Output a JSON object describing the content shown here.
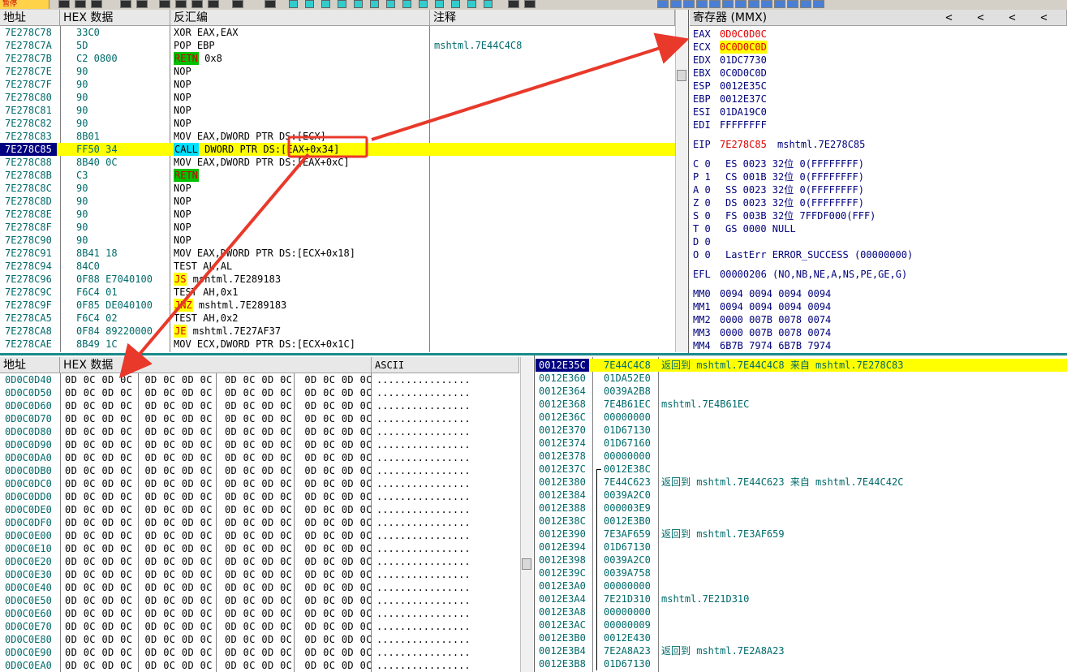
{
  "toolbar": {
    "label": "暂停"
  },
  "cpu": {
    "headers": {
      "addr": "地址",
      "hex": "HEX 数据",
      "disasm": "反汇编",
      "comment": "注释"
    },
    "rows": [
      {
        "addr": "7E278C78",
        "hex": "33C0",
        "disasm": "XOR EAX,EAX",
        "comment": ""
      },
      {
        "addr": "7E278C7A",
        "hex": "5D",
        "disasm": "POP EBP",
        "comment": "mshtml.7E44C4C8"
      },
      {
        "addr": "7E278C7B",
        "hex": "C2 0800",
        "mnem": "RETN",
        "kind": "retn",
        "rest": " 0x8",
        "comment": ""
      },
      {
        "addr": "7E278C7E",
        "hex": "90",
        "disasm": "NOP",
        "comment": ""
      },
      {
        "addr": "7E278C7F",
        "hex": "90",
        "disasm": "NOP",
        "comment": ""
      },
      {
        "addr": "7E278C80",
        "hex": "90",
        "disasm": "NOP",
        "comment": ""
      },
      {
        "addr": "7E278C81",
        "hex": "90",
        "disasm": "NOP",
        "comment": ""
      },
      {
        "addr": "7E278C82",
        "hex": "90",
        "disasm": "NOP",
        "comment": ""
      },
      {
        "addr": "7E278C83",
        "hex": "8B01",
        "disasm": "MOV EAX,DWORD PTR DS:[ECX]",
        "comment": ""
      },
      {
        "addr": "7E278C85",
        "hex": "FF50 34",
        "mnem": "CALL",
        "kind": "call",
        "rest": " DWORD PTR DS:[EAX+0x34]",
        "comment": "",
        "current": true
      },
      {
        "addr": "7E278C88",
        "hex": "8B40 0C",
        "disasm": "MOV EAX,DWORD PTR DS:[EAX+0xC]",
        "comment": ""
      },
      {
        "addr": "7E278C8B",
        "hex": "C3",
        "mnem": "RETN",
        "kind": "retn",
        "rest": "",
        "comment": ""
      },
      {
        "addr": "7E278C8C",
        "hex": "90",
        "disasm": "NOP",
        "comment": ""
      },
      {
        "addr": "7E278C8D",
        "hex": "90",
        "disasm": "NOP",
        "comment": ""
      },
      {
        "addr": "7E278C8E",
        "hex": "90",
        "disasm": "NOP",
        "comment": ""
      },
      {
        "addr": "7E278C8F",
        "hex": "90",
        "disasm": "NOP",
        "comment": ""
      },
      {
        "addr": "7E278C90",
        "hex": "90",
        "disasm": "NOP",
        "comment": ""
      },
      {
        "addr": "7E278C91",
        "hex": "8B41 18",
        "disasm": "MOV EAX,DWORD PTR DS:[ECX+0x18]",
        "comment": ""
      },
      {
        "addr": "7E278C94",
        "hex": "84C0",
        "disasm": "TEST AL,AL",
        "comment": ""
      },
      {
        "addr": "7E278C96",
        "hex": "0F88 E7040100",
        "mnem": "JS",
        "kind": "jcc",
        "rest": " mshtml.7E289183",
        "comment": ""
      },
      {
        "addr": "7E278C9C",
        "hex": "F6C4 01",
        "disasm": "TEST AH,0x1",
        "comment": ""
      },
      {
        "addr": "7E278C9F",
        "hex": "0F85 DE040100",
        "mnem": "JNZ",
        "kind": "jcc",
        "rest": " mshtml.7E289183",
        "comment": ""
      },
      {
        "addr": "7E278CA5",
        "hex": "F6C4 02",
        "disasm": "TEST AH,0x2",
        "comment": ""
      },
      {
        "addr": "7E278CA8",
        "hex": "0F84 89220000",
        "mnem": "JE",
        "kind": "jcc",
        "rest": " mshtml.7E27AF37",
        "comment": ""
      },
      {
        "addr": "7E278CAE",
        "hex": "8B49 1C",
        "disasm": "MOV ECX,DWORD PTR DS:[ECX+0x1C]",
        "comment": ""
      }
    ]
  },
  "registers": {
    "header": "寄存器 (MMX)",
    "arrows": [
      "<",
      "<",
      "<",
      "<",
      "<"
    ],
    "lines": [
      {
        "name": "EAX",
        "value": "0D0C0D0C",
        "style": "changed"
      },
      {
        "name": "ECX",
        "value": "0C0D0C0D",
        "style": "changed-hl"
      },
      {
        "name": "EDX",
        "value": "01DC7730"
      },
      {
        "name": "EBX",
        "value": "0C0D0C0D"
      },
      {
        "name": "ESP",
        "value": "0012E35C"
      },
      {
        "name": "EBP",
        "value": "0012E37C"
      },
      {
        "name": "ESI",
        "value": "01DA19C0"
      },
      {
        "name": "EDI",
        "value": "FFFFFFFF"
      },
      {
        "gap": true
      },
      {
        "name": "EIP",
        "value": "7E278C85",
        "style": "changed",
        "extra": "mshtml.7E278C85"
      },
      {
        "gap": true
      },
      {
        "name": "C 0",
        "value": "ES 0023 32位 0(FFFFFFFF)"
      },
      {
        "name": "P 1",
        "value": "CS 001B 32位 0(FFFFFFFF)"
      },
      {
        "name": "A 0",
        "value": "SS 0023 32位 0(FFFFFFFF)"
      },
      {
        "name": "Z 0",
        "value": "DS 0023 32位 0(FFFFFFFF)"
      },
      {
        "name": "S 0",
        "value": "FS 003B 32位 7FFDF000(FFF)"
      },
      {
        "name": "T 0",
        "value": "GS 0000 NULL"
      },
      {
        "name": "D 0",
        "value": ""
      },
      {
        "name": "O 0",
        "value": "LastErr ERROR_SUCCESS (00000000)"
      },
      {
        "gap": true
      },
      {
        "name": "EFL",
        "value": "00000206 (NO,NB,NE,A,NS,PE,GE,G)"
      },
      {
        "gap": true
      },
      {
        "name": "MM0",
        "value": "0094 0094 0094 0094"
      },
      {
        "name": "MM1",
        "value": "0094 0094 0094 0094"
      },
      {
        "name": "MM2",
        "value": "0000 007B 0078 0074"
      },
      {
        "name": "MM3",
        "value": "0000 007B 0078 0074"
      },
      {
        "name": "MM4",
        "value": "6B7B 7974 6B7B 7974"
      }
    ]
  },
  "dump": {
    "headers": {
      "addr": "地址",
      "hex": "HEX 数据",
      "ascii": "ASCII"
    },
    "bytes": "0D 0C 0D 0C  0D 0C 0D 0C  0D 0C 0D 0C  0D 0C 0D 0C",
    "ascii": "................",
    "rows": [
      "0D0C0D40",
      "0D0C0D50",
      "0D0C0D60",
      "0D0C0D70",
      "0D0C0D80",
      "0D0C0D90",
      "0D0C0DA0",
      "0D0C0DB0",
      "0D0C0DC0",
      "0D0C0DD0",
      "0D0C0DE0",
      "0D0C0DF0",
      "0D0C0E00",
      "0D0C0E10",
      "0D0C0E20",
      "0D0C0E30",
      "0D0C0E40",
      "0D0C0E50",
      "0D0C0E60",
      "0D0C0E70",
      "0D0C0E80",
      "0D0C0E90",
      "0D0C0EA0"
    ]
  },
  "stack": {
    "rows": [
      {
        "addr": "0012E35C",
        "value": "7E44C4C8",
        "comment": "返回到 mshtml.7E44C4C8 来自 mshtml.7E278C83",
        "current": true
      },
      {
        "addr": "0012E360",
        "value": "01DA52E0",
        "comment": ""
      },
      {
        "addr": "0012E364",
        "value": "0039A2B8",
        "comment": ""
      },
      {
        "addr": "0012E368",
        "value": "7E4B61EC",
        "comment": "mshtml.7E4B61EC"
      },
      {
        "addr": "0012E36C",
        "value": "00000000",
        "comment": ""
      },
      {
        "addr": "0012E370",
        "value": "01D67130",
        "comment": ""
      },
      {
        "addr": "0012E374",
        "value": "01D67160",
        "comment": ""
      },
      {
        "addr": "0012E378",
        "value": "00000000",
        "comment": ""
      },
      {
        "addr": "0012E37C",
        "value": "0012E38C",
        "comment": "",
        "bracket": "start"
      },
      {
        "addr": "0012E380",
        "value": "7E44C623",
        "comment": "返回到 mshtml.7E44C623 来自 mshtml.7E44C42C",
        "bracket": "mid"
      },
      {
        "addr": "0012E384",
        "value": "0039A2C0",
        "comment": "",
        "bracket": "mid"
      },
      {
        "addr": "0012E388",
        "value": "000003E9",
        "comment": "",
        "bracket": "mid"
      },
      {
        "addr": "0012E38C",
        "value": "0012E3B0",
        "comment": "",
        "bracket": "end"
      },
      {
        "addr": "0012E390",
        "value": "7E3AF659",
        "comment": "返回到 mshtml.7E3AF659",
        "bracket": "mid"
      },
      {
        "addr": "0012E394",
        "value": "01D67130",
        "comment": "",
        "bracket": "mid"
      },
      {
        "addr": "0012E398",
        "value": "0039A2C0",
        "comment": "",
        "bracket": "mid"
      },
      {
        "addr": "0012E39C",
        "value": "0039A758",
        "comment": "",
        "bracket": "mid"
      },
      {
        "addr": "0012E3A0",
        "value": "00000000",
        "comment": "",
        "bracket": "mid"
      },
      {
        "addr": "0012E3A4",
        "value": "7E21D310",
        "comment": "mshtml.7E21D310",
        "bracket": "mid"
      },
      {
        "addr": "0012E3A8",
        "value": "00000000",
        "comment": "",
        "bracket": "mid"
      },
      {
        "addr": "0012E3AC",
        "value": "00000009",
        "comment": "",
        "bracket": "mid"
      },
      {
        "addr": "0012E3B0",
        "value": "0012E430",
        "comment": "",
        "bracket": "end"
      },
      {
        "addr": "0012E3B4",
        "value": "7E2A8A23",
        "comment": "返回到 mshtml.7E2A8A23",
        "bracket": "mid"
      },
      {
        "addr": "0012E3B8",
        "value": "01D67130",
        "comment": "",
        "bracket": "mid"
      }
    ]
  },
  "colors": {
    "highlight": "#ffff00",
    "selection": "#000080",
    "annotation": "#e8392b",
    "teal": "#006a6a"
  }
}
